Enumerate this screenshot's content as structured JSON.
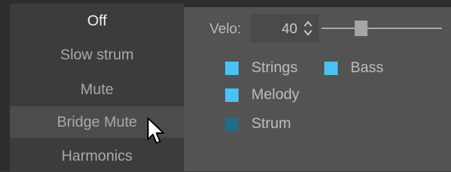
{
  "menu": {
    "items": [
      {
        "label": "Off",
        "selected": true
      },
      {
        "label": "Slow strum"
      },
      {
        "label": "Mute"
      },
      {
        "label": "Bridge Mute",
        "hovered": true
      },
      {
        "label": "Harmonics"
      }
    ]
  },
  "velocity": {
    "label": "Velo:",
    "value": "40",
    "spin_icon": "up-down-chevron-icon",
    "slider_fraction": 0.31
  },
  "checkboxes": [
    {
      "label": "Strings",
      "checked": true
    },
    {
      "label": "Bass",
      "checked": true
    },
    {
      "label": "Melody",
      "checked": true
    },
    {
      "label": "Strum",
      "checked": false
    }
  ],
  "colors": {
    "checkbox_on": "#4ac2f4",
    "checkbox_off": "#246a8a"
  },
  "cursor_icon": "mouse-pointer-icon"
}
